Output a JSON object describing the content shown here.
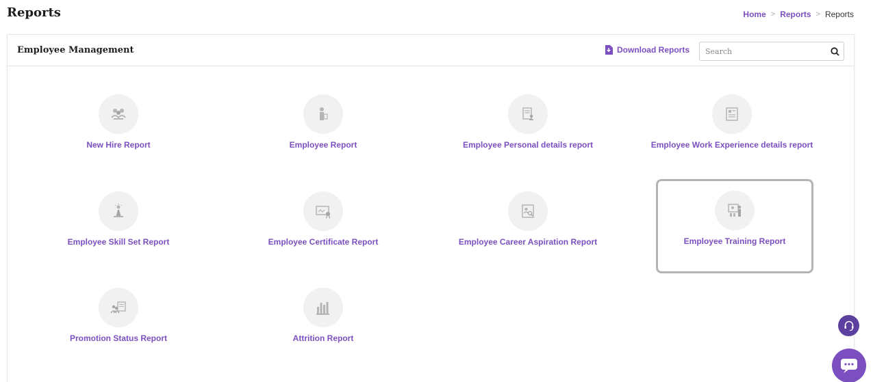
{
  "page": {
    "title": "Reports"
  },
  "breadcrumb": {
    "home": "Home",
    "reports": "Reports",
    "current": "Reports",
    "separator": ">"
  },
  "card": {
    "title": "Employee Management",
    "download_label": "Download Reports",
    "search_placeholder": "Search"
  },
  "reports": [
    {
      "label": "New Hire Report",
      "icon": "new-hire-icon"
    },
    {
      "label": "Employee Report",
      "icon": "employee-icon"
    },
    {
      "label": "Employee Personal details report",
      "icon": "personal-details-icon"
    },
    {
      "label": "Employee Work Experience details report",
      "icon": "work-experience-icon"
    },
    {
      "label": "Employee Skill Set Report",
      "icon": "skill-set-icon"
    },
    {
      "label": "Employee Certificate Report",
      "icon": "certificate-icon"
    },
    {
      "label": "Employee Career Aspiration Report",
      "icon": "career-aspiration-icon"
    },
    {
      "label": "Employee Training Report",
      "icon": "training-icon",
      "selected": true
    },
    {
      "label": "Promotion Status Report",
      "icon": "promotion-status-icon"
    },
    {
      "label": "Attrition Report",
      "icon": "attrition-icon"
    }
  ],
  "colors": {
    "accent": "#7b4fbf",
    "support": "#5d3fa0",
    "icon_bg": "#f1f1f1",
    "icon_fg": "#b5b5b5",
    "selected_border": "#b3b3b3"
  },
  "widgets": {
    "support_icon": "headset-icon",
    "chat_icon": "chat-icon"
  }
}
